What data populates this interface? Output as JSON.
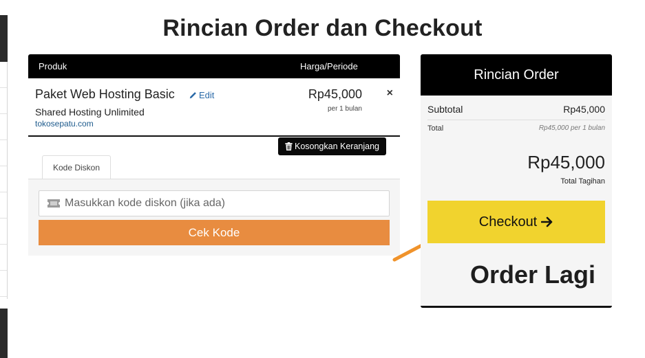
{
  "page": {
    "title": "Rincian Order dan Checkout"
  },
  "cart": {
    "headers": {
      "product": "Produk",
      "price": "Harga/Periode"
    },
    "items": [
      {
        "name": "Paket Web Hosting Basic",
        "edit_label": "Edit",
        "group": "Shared Hosting Unlimited",
        "domain": "tokosepatu.com",
        "price": "Rp45,000",
        "period": "per 1 bulan",
        "remove_symbol": "×"
      }
    ],
    "empty_cart_label": "Kosongkan Keranjang"
  },
  "discount": {
    "tab_label": "Kode Diskon",
    "input_placeholder": "Masukkan kode diskon (jika ada)",
    "input_value": "",
    "check_button": "Cek Kode"
  },
  "summary": {
    "title": "Rincian Order",
    "subtotal_label": "Subtotal",
    "subtotal_value": "Rp45,000",
    "total_label": "Total",
    "total_value": "Rp45,000 per 1 bulan",
    "due_amount": "Rp45,000",
    "due_label": "Total Tagihan",
    "checkout_label": "Checkout",
    "order_again_label": "Order Lagi"
  },
  "colors": {
    "header_black": "#000000",
    "checkout_yellow": "#f1d32e",
    "check_button_orange": "#e88c40",
    "annotation_arrow": "#f0932b",
    "link_blue": "#2a6aa8"
  },
  "icons": {
    "edit": "pencil-icon",
    "empty_cart": "trash-icon",
    "coupon": "ticket-icon",
    "checkout": "arrow-right-icon"
  }
}
